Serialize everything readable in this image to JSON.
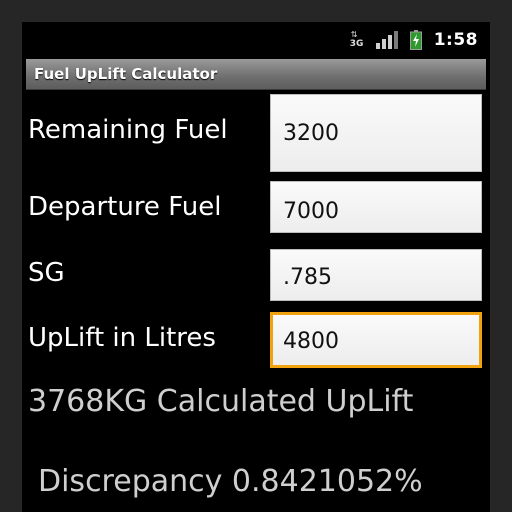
{
  "status_bar": {
    "network_type": "3G",
    "time": "1:58",
    "icons": [
      "data-activity-3g-icon",
      "signal-strength-icon",
      "battery-charging-icon"
    ]
  },
  "app": {
    "title": "Fuel UpLift Calculator"
  },
  "form": {
    "remaining_fuel": {
      "label": "Remaining Fuel",
      "value": "3200"
    },
    "departure_fuel": {
      "label": "Departure Fuel",
      "value": "7000"
    },
    "sg": {
      "label": "SG",
      "value": ".785"
    },
    "uplift_litres": {
      "label": "UpLift in Litres",
      "value": "4800"
    }
  },
  "results": {
    "calculated_uplift": "3768KG Calculated UpLift",
    "discrepancy": "Discrepancy 0.8421052%"
  },
  "colors": {
    "background": "#000000",
    "focus_border": "#f2a10f",
    "result_text": "#cfcfcf"
  }
}
